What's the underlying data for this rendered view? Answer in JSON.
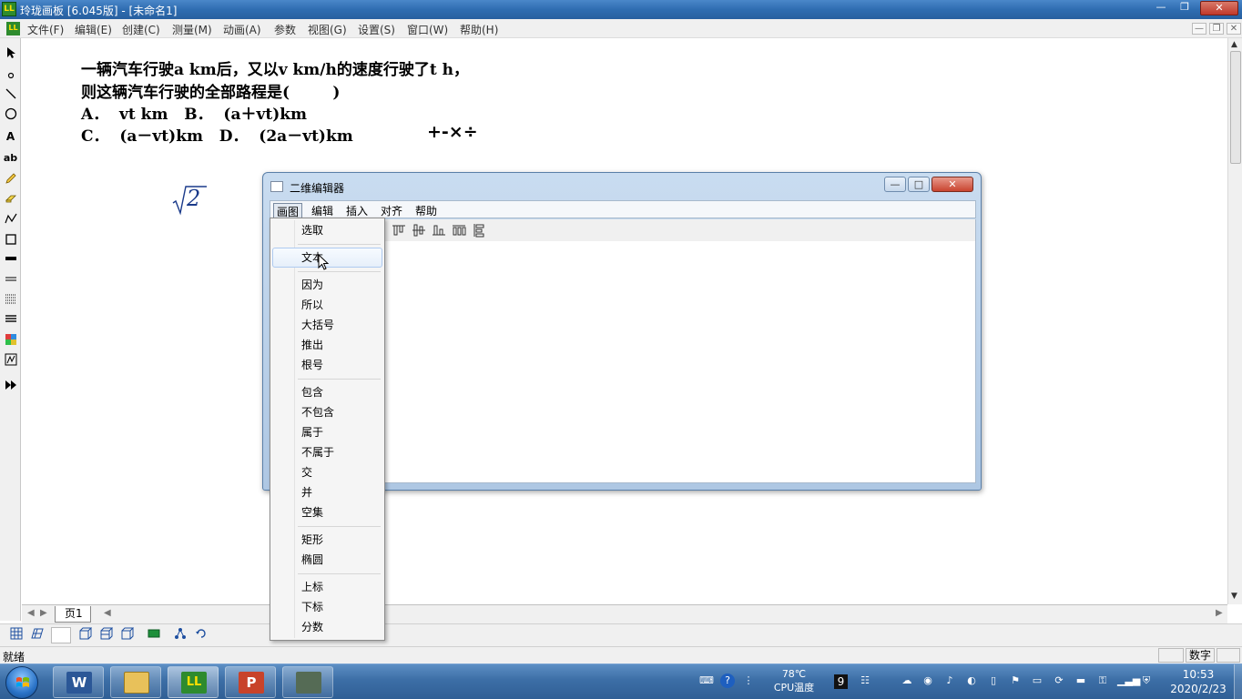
{
  "window": {
    "title": "玲珑画板 [6.045版] - [未命名1]",
    "icon": "LL",
    "controls": {
      "minimize": "—",
      "maximize": "❐",
      "close": "✕"
    }
  },
  "menubar": {
    "icon": "LL",
    "items": [
      "文件(F)",
      "编辑(E)",
      "创建(C)",
      "测量(M)",
      "动画(A)",
      "参数",
      "视图(G)",
      "设置(S)",
      "窗口(W)",
      "帮助(H)"
    ],
    "mdi_controls": {
      "minimize": "—",
      "restore": "❐",
      "close": "✕"
    }
  },
  "toolbar_left": {
    "text_tool_label": "A",
    "label_tool_label": "ab",
    "icons": [
      "arrow-pointer-icon",
      "point-icon",
      "line-icon",
      "circle-icon",
      "text-icon",
      "label-icon",
      "pencil-icon",
      "eraser-icon",
      "polyline-icon",
      "rectangle-icon",
      "thick-line-icon",
      "double-line-icon",
      "dotted-list-icon",
      "lines-icon",
      "color-palette-icon",
      "graph-icon",
      "fast-forward-icon"
    ]
  },
  "canvas": {
    "problem_lines": [
      "一辆汽车行驶a km后，又以v km/h的速度行驶了t h，",
      "则这辆汽车行驶的全部路程是(        )",
      "A．  vt km   B．  (a＋vt)km",
      "C．  (a－vt)km   D．  (2a－vt)km"
    ],
    "operators": "+-×÷",
    "sqrt_radicand": "2"
  },
  "page_tabs": {
    "current": "页1",
    "nav_prev": "◀",
    "nav_next": "▶"
  },
  "statusbar": {
    "status": "就绪",
    "num_indicator": "数字"
  },
  "dialog": {
    "title": "二维编辑器",
    "controls": {
      "minimize": "—",
      "maximize": "□",
      "close": "✕"
    },
    "menu": [
      "画图",
      "编辑",
      "插入",
      "对齐",
      "帮助"
    ],
    "active_menu": "画图"
  },
  "dropdown": {
    "groups": [
      [
        "选取"
      ],
      [
        "文本"
      ],
      [
        "因为",
        "所以",
        "大括号",
        "推出",
        "根号"
      ],
      [
        "包含",
        "不包含",
        "属于",
        "不属于",
        "交",
        "并",
        "空集"
      ],
      [
        "矩形",
        "椭圆"
      ],
      [
        "上标",
        "下标",
        "分数"
      ]
    ],
    "hovered": "文本"
  },
  "taskbar": {
    "apps": [
      "word-icon",
      "file-explorer-icon",
      "linglong-icon",
      "powerpoint-icon",
      "software-icon"
    ],
    "app_glyphs": {
      "word": "W",
      "linglong": "LL",
      "powerpoint": "P"
    },
    "tray_temp_value": "78℃",
    "tray_temp_label": "CPU温度",
    "tray_badge": "9",
    "time": "10:53",
    "date": "2020/2/23"
  },
  "colors": {
    "titlebar": "#2f6db1",
    "taskbar": "#3c6ea6",
    "sqrt_color": "#1a3a8a",
    "menu_hover": "#e6effa"
  }
}
